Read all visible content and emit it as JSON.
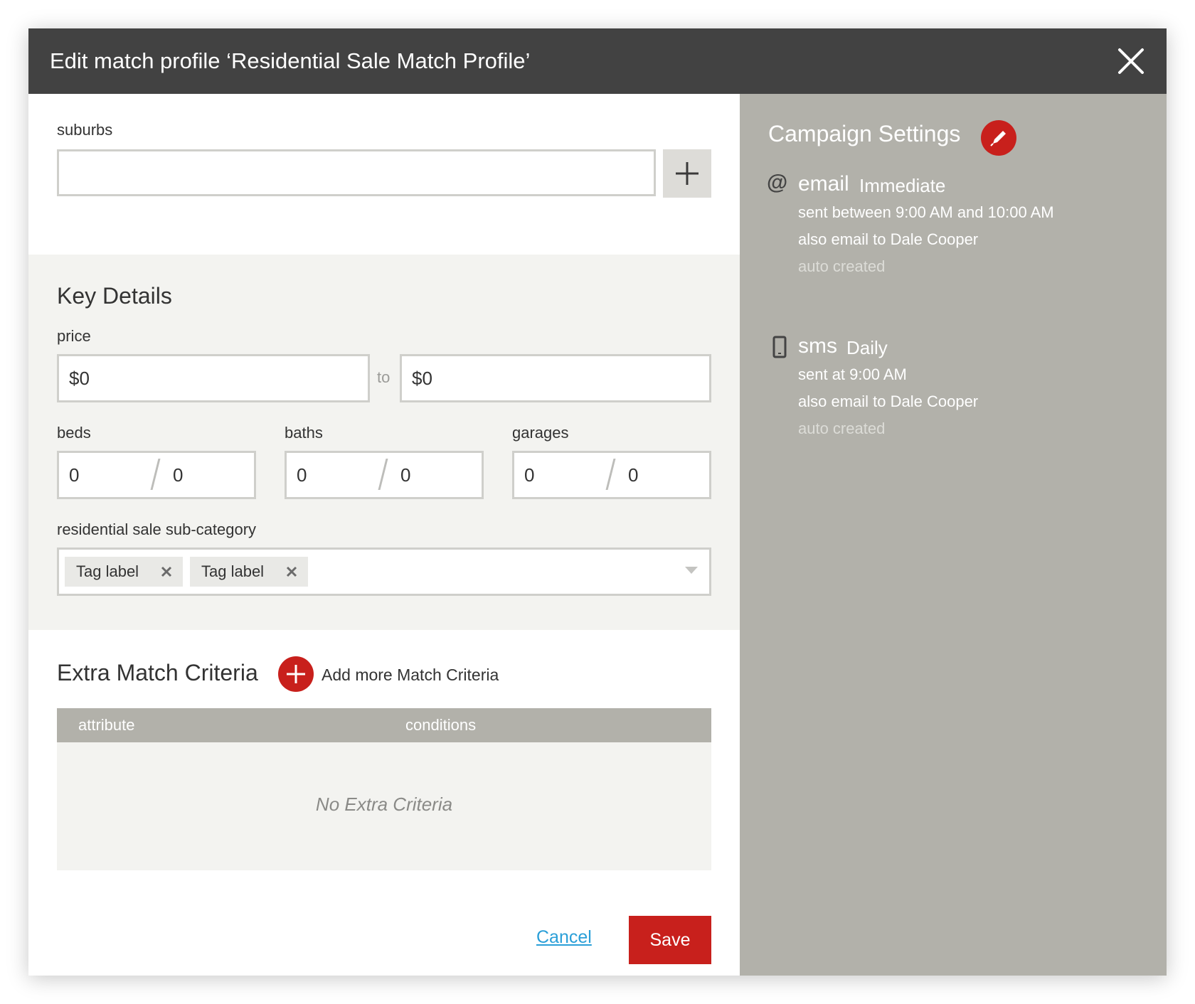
{
  "dialog": {
    "title": "Edit match profile ‘Residential Sale Match Profile’"
  },
  "suburbs": {
    "label": "suburbs",
    "value": "",
    "placeholder": ""
  },
  "key_details": {
    "title": "Key Details",
    "price": {
      "label": "price",
      "min": "$0",
      "separator": "to",
      "max": "$0"
    },
    "beds": {
      "label": "beds",
      "min": "0",
      "max": "0"
    },
    "baths": {
      "label": "baths",
      "min": "0",
      "max": "0"
    },
    "garages": {
      "label": "garages",
      "min": "0",
      "max": "0"
    },
    "subcategory": {
      "label": "residential sale sub-category",
      "tags": [
        "Tag label",
        "Tag label"
      ]
    }
  },
  "extra_criteria": {
    "title": "Extra Match Criteria",
    "add_label": "Add more Match Criteria",
    "columns": [
      "attribute",
      "conditions"
    ],
    "empty_message": "No Extra Criteria"
  },
  "actions": {
    "cancel_label": "Cancel",
    "save_label": "Save"
  },
  "campaign": {
    "title": "Campaign Settings",
    "channels": [
      {
        "icon": "at-icon",
        "name": "email",
        "frequency": "Immediate",
        "schedule": "sent between 9:00 AM and 10:00 AM",
        "also": "also email to Dale Cooper",
        "note": "auto created"
      },
      {
        "icon": "mobile-phone-icon",
        "name": "sms",
        "frequency": "Daily",
        "schedule": "sent at 9:00 AM",
        "also": "also email to Dale Cooper",
        "note": "auto created"
      }
    ]
  },
  "colors": {
    "header": "#424242",
    "accent_red": "#c8201c",
    "panel_gray": "#b2b1aa",
    "link_blue": "#2a9fd8"
  }
}
